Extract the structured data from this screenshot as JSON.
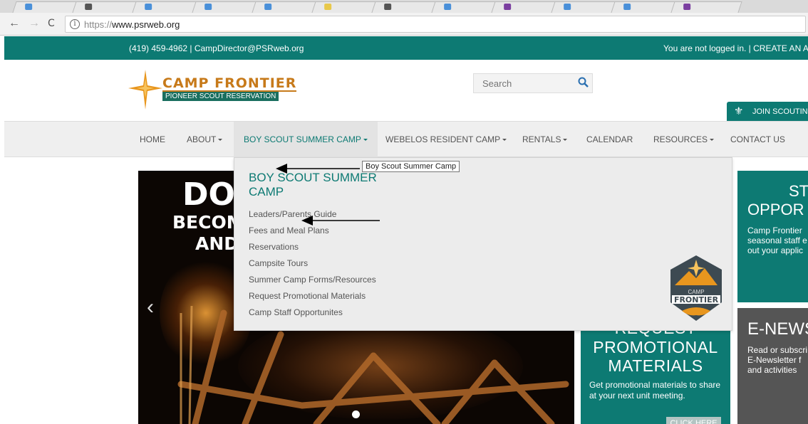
{
  "browser": {
    "back": "←",
    "forward": "→",
    "reload": "C",
    "info": "i",
    "url_scheme": "https://",
    "url_host": "www.psrweb.org",
    "tab_favicon_colors": [
      "#4a90d9",
      "#555555",
      "#4a90d9",
      "#4a90d9",
      "#4a90d9",
      "#e8c84a",
      "#555555",
      "#4a90d9",
      "#7b3fa0",
      "#4a90d9",
      "#4a90d9",
      "#7b3fa0"
    ]
  },
  "topbar": {
    "contact": "(419) 459-4962 | CampDirector@PSRweb.org",
    "login": "You are not logged in. | CREATE AN AC"
  },
  "logo": {
    "name": "CAMP FRONTIER",
    "subtitle": "PIONEER SCOUT RESERVATION"
  },
  "search": {
    "placeholder": "Search"
  },
  "join": {
    "label": "JOIN SCOUTING"
  },
  "nav": {
    "home": "HOME",
    "about": "ABOUT",
    "boy_scout": "BOY SCOUT SUMMER CAMP",
    "webelos": "WEBELOS RESIDENT CAMP",
    "rentals": "RENTALS",
    "calendar": "CALENDAR",
    "resources": "RESOURCES",
    "contact": "CONTACT US"
  },
  "dropdown": {
    "title": "BOY SCOUT SUMMER CAMP",
    "tooltip": "Boy Scout Summer Camp",
    "links": [
      "Leaders/Parents Guide",
      "Fees and Meal Plans",
      "Reservations",
      "Campsite Tours",
      "Summer Camp Forms/Resources",
      "Request Promotional Materials",
      "Camp Staff Opportunites"
    ],
    "logo_camp": "CAMP",
    "logo_frontier": "FRONTIER"
  },
  "hero": {
    "line1": "DO",
    "line2": "BECOM",
    "line3": "AND",
    "prev": "‹"
  },
  "promo": {
    "line0": "REQUEST",
    "line1": "PROMOTIONAL",
    "line2": "MATERIALS",
    "text": "Get promotional materials to share at your next unit meeting.",
    "button": "CLICK HERE"
  },
  "side1": {
    "line1": "ST",
    "line2": "OPPOR",
    "text_l1": "Camp Frontier",
    "text_l2": "seasonal staff e",
    "text_l3": "out your applic"
  },
  "side2": {
    "title": "E-NEWS",
    "text_l1": "Read or subscri",
    "text_l2": "E-Newsletter f",
    "text_l3": "and activities"
  },
  "colors": {
    "teal": "#0d7a73",
    "orange": "#c77a1a",
    "nav_bg": "#efefef",
    "dropdown_bg": "#ececec"
  }
}
